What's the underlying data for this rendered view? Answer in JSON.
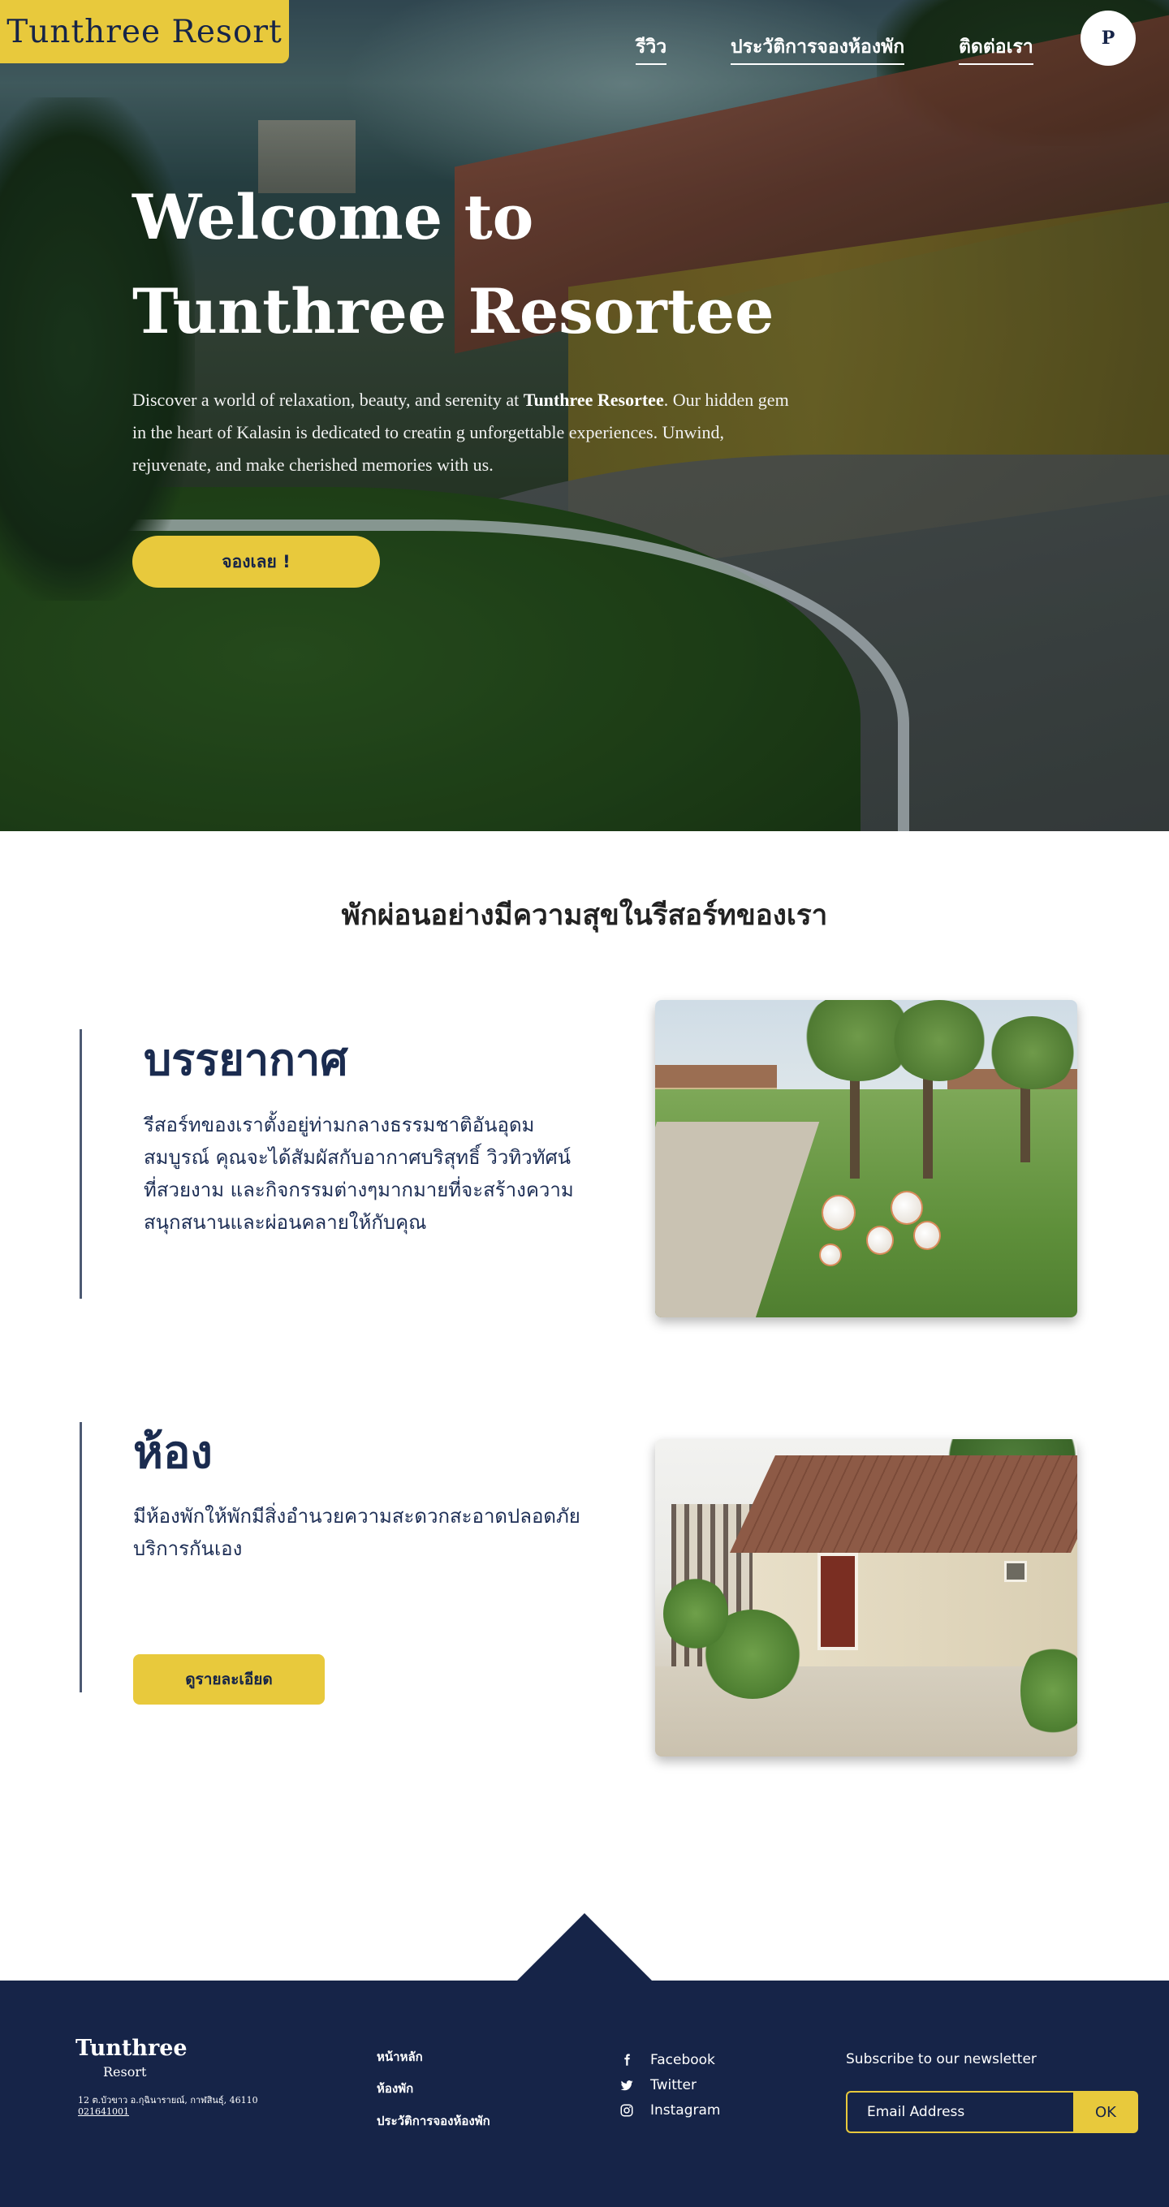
{
  "header": {
    "logo": "Tunthree  Resort",
    "nav": [
      {
        "label": "รีวิว"
      },
      {
        "label": "ประวัติการจองห้องพัก"
      },
      {
        "label": "ติดต่อเรา"
      }
    ],
    "avatar_initial": "P"
  },
  "hero": {
    "title_line1": "Welcome to",
    "title_line2": "Tunthree Resortee",
    "desc_pre": "Discover a world of relaxation, beauty, and serenity at ",
    "desc_bold": "Tunthree Resortee",
    "desc_post": ". Our hidden gem in the heart of Kalasin is dedicated to creatin    g unforgettable experiences. Unwind, rejuvenate, and make cherished memories with us.",
    "cta_label": "จองเลย !"
  },
  "tagline": "พักผ่อนอย่างมีความสุขในรีสอร์ทของเรา",
  "features": [
    {
      "title": "บรรยากาศ",
      "text": "รีสอร์ทของเราตั้งอยู่ท่ามกลางธรรมชาติอันอุดมสมบูรณ์ คุณจะได้สัมผัสกับอากาศบริสุทธิ์ วิวทิวทัศน์ที่สวยงาม และกิจกรรมต่างๆมากมายที่จะสร้างความสนุกสนานและผ่อนคลายให้กับคุณ"
    },
    {
      "title": "ห้อง",
      "text": "มีห้องพักให้พักมีสิ่งอำนวยความสะดวกสะอาดปลอดภัย บริการกันเอง",
      "button_label": "ดูรายละเอียด"
    }
  ],
  "footer": {
    "brand_line1": "Tunthree",
    "brand_line2": "Resort",
    "address": "12 ต.บัวขาว อ.กุฉินารายณ์, กาฬสินธุ์, 46110",
    "phone": "021641001",
    "links": [
      "หน้าหลัก",
      "ห้องพัก",
      "ประวัติการจองห้องพัก"
    ],
    "social": [
      {
        "icon": "facebook-icon",
        "label": "Facebook"
      },
      {
        "icon": "twitter-icon",
        "label": "Twitter"
      },
      {
        "icon": "instagram-icon",
        "label": "Instagram"
      }
    ],
    "newsletter_title": "Subscribe to our newsletter",
    "email_placeholder": "Email Address",
    "ok_label": "OK"
  },
  "colors": {
    "accent": "#e8c93c",
    "navy": "#162448"
  }
}
